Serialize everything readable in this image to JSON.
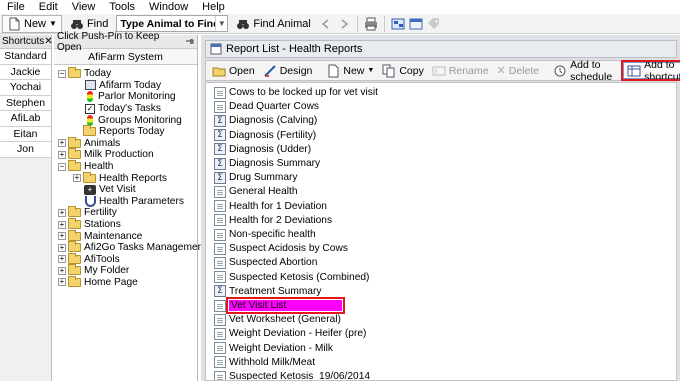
{
  "menu": [
    "File",
    "Edit",
    "View",
    "Tools",
    "Window",
    "Help"
  ],
  "toolbar": {
    "new_label": "New",
    "find_label": "Find",
    "animal_combo": "Type Animal to Find",
    "find_animal_label": "Find Animal"
  },
  "shortcuts": {
    "title": "Shortcuts",
    "close": "✕",
    "items": [
      "Standard",
      "Jackie",
      "Yochai",
      "Stephen",
      "AfiLab",
      "Eitan",
      "Jon"
    ]
  },
  "nav": {
    "pin_hint": "Click Push-Pin to Keep Open",
    "system": "AfiFarm System",
    "tree": [
      {
        "label": "Today",
        "expander": "−",
        "level": 0,
        "icon": "folder-open-icon"
      },
      {
        "label": "Afifarm Today",
        "level": 1,
        "icon": "report-icon"
      },
      {
        "label": "Parlor Monitoring",
        "level": 1,
        "icon": "traffic-light-icon"
      },
      {
        "label": "Today's Tasks",
        "level": 1,
        "icon": "checkbox-icon"
      },
      {
        "label": "Groups Monitoring",
        "level": 1,
        "icon": "traffic-light-icon"
      },
      {
        "label": "Reports Today",
        "level": 1,
        "icon": "folder-icon"
      },
      {
        "label": "Animals",
        "expander": "+",
        "level": 0,
        "icon": "folder-icon"
      },
      {
        "label": "Milk Production",
        "expander": "+",
        "level": 0,
        "icon": "folder-icon"
      },
      {
        "label": "Health",
        "expander": "−",
        "level": 0,
        "icon": "folder-open-icon"
      },
      {
        "label": "Health Reports",
        "expander": "+",
        "level": 1,
        "icon": "folder-icon"
      },
      {
        "label": "Vet Visit",
        "level": 1,
        "icon": "vet-case-icon"
      },
      {
        "label": "Health Parameters",
        "level": 1,
        "icon": "stethoscope-icon"
      },
      {
        "label": "Fertility",
        "expander": "+",
        "level": 0,
        "icon": "folder-icon"
      },
      {
        "label": "Stations",
        "expander": "+",
        "level": 0,
        "icon": "folder-icon"
      },
      {
        "label": "Maintenance",
        "expander": "+",
        "level": 0,
        "icon": "folder-icon"
      },
      {
        "label": "Afi2Go Tasks Management",
        "expander": "+",
        "level": 0,
        "icon": "folder-icon"
      },
      {
        "label": "AfiTools",
        "expander": "+",
        "level": 0,
        "icon": "folder-icon"
      },
      {
        "label": "My Folder",
        "expander": "+",
        "level": 0,
        "icon": "folder-icon"
      },
      {
        "label": "Home Page",
        "expander": "+",
        "level": 0,
        "icon": "folder-icon"
      }
    ]
  },
  "report": {
    "title": "Report List - Health Reports",
    "actions": {
      "open": "Open",
      "design": "Design",
      "new": "New",
      "copy": "Copy",
      "rename": "Rename",
      "delete": "Delete",
      "add_schedule": "Add to schedule",
      "add_shortcut": "Add to shortcut"
    },
    "items": [
      {
        "label": "Cows to be locked up for vet visit",
        "icon": "doc"
      },
      {
        "label": "Dead Quarter Cows",
        "icon": "doc"
      },
      {
        "label": "Diagnosis (Calving)",
        "icon": "sigma"
      },
      {
        "label": "Diagnosis (Fertility)",
        "icon": "sigma"
      },
      {
        "label": "Diagnosis (Udder)",
        "icon": "sigma"
      },
      {
        "label": "Diagnosis Summary",
        "icon": "sigma"
      },
      {
        "label": "Drug Summary",
        "icon": "sigma"
      },
      {
        "label": "General Health",
        "icon": "doc"
      },
      {
        "label": "Health for 1 Deviation",
        "icon": "doc"
      },
      {
        "label": "Health for 2 Deviations",
        "icon": "doc"
      },
      {
        "label": "Non-specific health",
        "icon": "doc"
      },
      {
        "label": "Suspect Acidosis by Cows",
        "icon": "doc"
      },
      {
        "label": "Suspected Abortion",
        "icon": "doc"
      },
      {
        "label": "Suspected Ketosis (Combined)",
        "icon": "doc"
      },
      {
        "label": "Treatment Summary",
        "icon": "sigma"
      },
      {
        "label": "Vet Visit List",
        "icon": "doc",
        "selected": true
      },
      {
        "label": "Vet Worksheet (General)",
        "icon": "doc"
      },
      {
        "label": "Weight Deviation - Heifer (pre)",
        "icon": "doc"
      },
      {
        "label": "Weight Deviation - Milk",
        "icon": "doc"
      },
      {
        "label": "Withhold Milk/Meat",
        "icon": "doc"
      },
      {
        "label": "Suspected Ketosis_19/06/2014",
        "icon": "doc"
      }
    ]
  },
  "colors": {
    "selection": "#ff00ff",
    "highlight_outline": "#e3161c",
    "folder": "#f4d26c"
  }
}
